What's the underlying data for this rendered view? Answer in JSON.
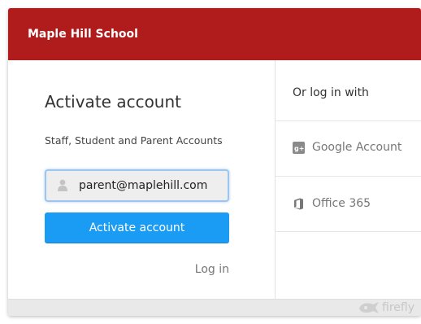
{
  "header": {
    "school_name": "Maple Hill School",
    "background_color": "#b01c1c"
  },
  "activate": {
    "heading": "Activate account",
    "subheading": "Staff, Student and Parent Accounts",
    "email_field": {
      "value": "parent@maplehill.com",
      "icon": "user-icon"
    },
    "button_label": "Activate account",
    "button_color": "#1a9cf5",
    "login_link": "Log in"
  },
  "alt_login": {
    "heading": "Or log in with",
    "providers": [
      {
        "label": "Google Account",
        "icon": "google-plus-icon"
      },
      {
        "label": "Office 365",
        "icon": "office-icon"
      }
    ]
  },
  "footer": {
    "brand": "firefly",
    "brand_icon": "firefly-logo-icon"
  }
}
